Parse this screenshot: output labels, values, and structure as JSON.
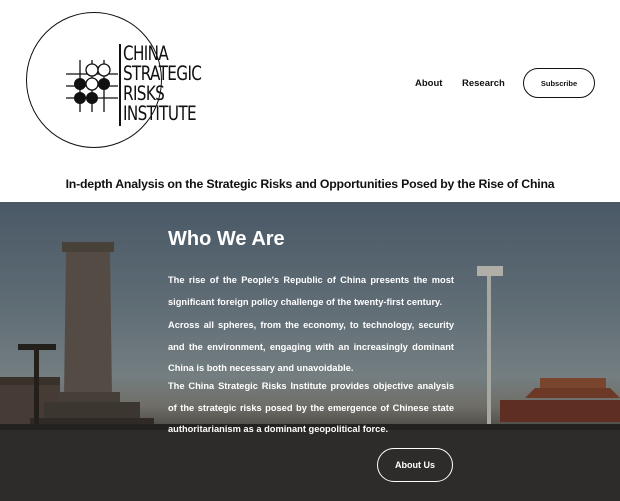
{
  "logo": {
    "lines": [
      "CHINA",
      "STRATEGIC",
      "RISKS",
      "INSTITUTE"
    ]
  },
  "nav": {
    "about": "About",
    "research": "Research",
    "subscribe": "Subscribe"
  },
  "tagline": "In-depth Analysis on the Strategic Risks and Opportunities Posed by the Rise of China",
  "hero": {
    "title": "Who We Are",
    "paragraphs": [
      "The rise of the People's Republic of China presents the most significant foreign policy challenge of the twenty-first century.",
      "Across all spheres, from the economy, to technology, security and the environment, engaging with an increasingly dominant China is both necessary and unavoidable.",
      "The China Strategic Risks Institute provides objective analysis of the strategic risks posed by the emergence of Chinese state authoritarianism as a dominant geopolitical force."
    ],
    "button": "About Us"
  }
}
